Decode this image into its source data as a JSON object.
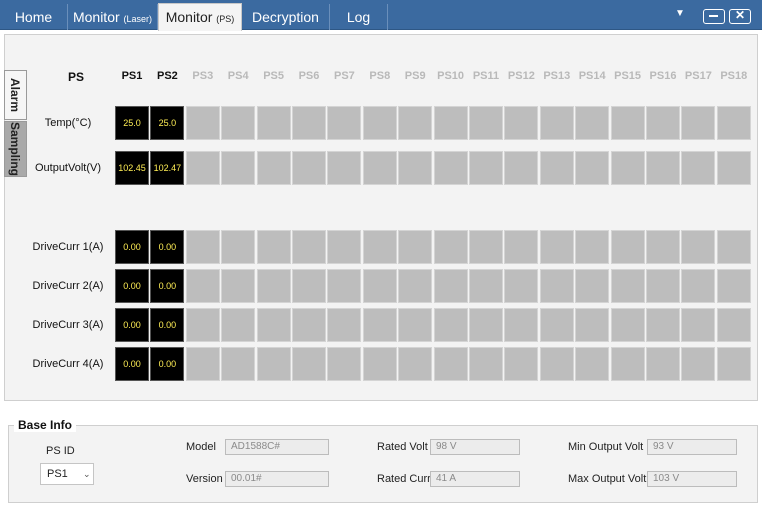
{
  "tabs": {
    "home": "Home",
    "monitor_laser": "Monitor",
    "monitor_laser_sub": "(Laser)",
    "monitor_ps": "Monitor",
    "monitor_ps_sub": "(PS)",
    "decryption": "Decryption",
    "log": "Log"
  },
  "window": {
    "dropdown": "▼",
    "minimize": "—",
    "close": "✕"
  },
  "side_tabs": {
    "alarm": "Alarm",
    "sampling": "Sampling"
  },
  "grid": {
    "ps_header": "PS",
    "columns": [
      "PS1",
      "PS2",
      "PS3",
      "PS4",
      "PS5",
      "PS6",
      "PS7",
      "PS8",
      "PS9",
      "PS10",
      "PS11",
      "PS12",
      "PS13",
      "PS14",
      "PS15",
      "PS16",
      "PS17",
      "PS18"
    ],
    "active_columns": 2,
    "rows": [
      {
        "label": "Temp(°C)",
        "values": [
          "25.0",
          "25.0"
        ]
      },
      {
        "label": "OutputVolt(V)",
        "values": [
          "102.45",
          "102.47"
        ]
      },
      {
        "label": "DriveCurr 1(A)",
        "values": [
          "0.00",
          "0.00"
        ]
      },
      {
        "label": "DriveCurr 2(A)",
        "values": [
          "0.00",
          "0.00"
        ]
      },
      {
        "label": "DriveCurr 3(A)",
        "values": [
          "0.00",
          "0.00"
        ]
      },
      {
        "label": "DriveCurr 4(A)",
        "values": [
          "0.00",
          "0.00"
        ]
      }
    ]
  },
  "base_info": {
    "title": "Base Info",
    "ps_id_label": "PS ID",
    "ps_id_value": "PS1",
    "chevron": "⌄",
    "model_label": "Model",
    "model_value": "AD1588C#",
    "version_label": "Version",
    "version_value": "00.01#",
    "rated_volt_label": "Rated Volt",
    "rated_volt_value": "98 V",
    "rated_curr_label": "Rated Curr",
    "rated_curr_value": "41 A",
    "min_output_label": "Min Output Volt",
    "min_output_value": "93 V",
    "max_output_label": "Max Output Volt",
    "max_output_value": "103 V"
  }
}
